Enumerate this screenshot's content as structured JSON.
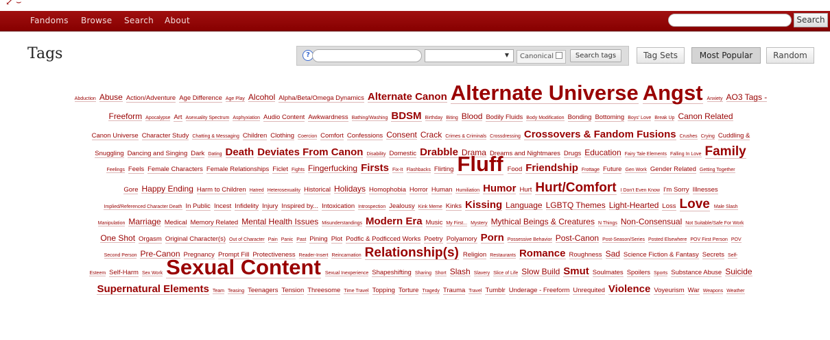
{
  "nav": {
    "items": [
      "Fandoms",
      "Browse",
      "Search",
      "About"
    ],
    "search_button": "Search",
    "search_placeholder": ""
  },
  "page": {
    "title": "Tags"
  },
  "tag_search": {
    "help_label": "?",
    "canonical_label": "Canonical",
    "search_button": "Search tags"
  },
  "buttons": {
    "tag_sets": "Tag Sets",
    "most_popular": "Most Popular",
    "random": "Random"
  },
  "colors": {
    "navbar": "#990000",
    "tag": "#990000"
  },
  "cloud": [
    [
      [
        "Abduction",
        1
      ],
      [
        "Abuse",
        3
      ],
      [
        "Action/Adventure",
        2
      ],
      [
        "Age Difference",
        2
      ],
      [
        "Age Play",
        1
      ],
      [
        "Alcohol",
        3
      ],
      [
        "Alpha/Beta/Omega Dynamics",
        2
      ],
      [
        "Alternate Canon",
        4
      ],
      [
        "Alternate Universe",
        6
      ],
      [
        "Angst",
        6
      ],
      [
        "Anxiety",
        1
      ],
      [
        "AO3 Tags -",
        3
      ]
    ],
    [
      [
        "Freeform",
        3
      ],
      [
        "Apocalypse",
        1
      ],
      [
        "Art",
        2
      ],
      [
        "Asexuality Spectrum",
        1
      ],
      [
        "Asphyxiation",
        1
      ],
      [
        "Audio Content",
        2
      ],
      [
        "Awkwardness",
        2
      ],
      [
        "Bathing/Washing",
        1
      ],
      [
        "BDSM",
        4
      ],
      [
        "Birthday",
        1
      ],
      [
        "Biting",
        1
      ],
      [
        "Blood",
        3
      ],
      [
        "Bodily Fluids",
        2
      ],
      [
        "Body Modification",
        1
      ],
      [
        "Bonding",
        2
      ],
      [
        "Bottoming",
        2
      ],
      [
        "Boys' Love",
        1
      ],
      [
        "Break Up",
        1
      ],
      [
        "Canon Related",
        3
      ]
    ],
    [
      [
        "Canon Universe",
        2
      ],
      [
        "Character Study",
        2
      ],
      [
        "Chatting & Messaging",
        1
      ],
      [
        "Children",
        2
      ],
      [
        "Clothing",
        2
      ],
      [
        "Coercion",
        1
      ],
      [
        "Comfort",
        2
      ],
      [
        "Confessions",
        2
      ],
      [
        "Consent",
        3
      ],
      [
        "Crack",
        3
      ],
      [
        "Crimes & Criminals",
        1
      ],
      [
        "Crossdressing",
        1
      ],
      [
        "Crossovers & Fandom Fusions",
        4
      ],
      [
        "Crushes",
        1
      ],
      [
        "Crying",
        1
      ],
      [
        "Cuddling &",
        2
      ]
    ],
    [
      [
        "Snuggling",
        2
      ],
      [
        "Dancing and Singing",
        2
      ],
      [
        "Dark",
        2
      ],
      [
        "Dating",
        1
      ],
      [
        "Death",
        4
      ],
      [
        "Deviates From Canon",
        4
      ],
      [
        "Disability",
        1
      ],
      [
        "Domestic",
        2
      ],
      [
        "Drabble",
        4
      ],
      [
        "Drama",
        3
      ],
      [
        "Dreams and Nightmares",
        2
      ],
      [
        "Drugs",
        2
      ],
      [
        "Education",
        3
      ],
      [
        "Fairy Tale Elements",
        1
      ],
      [
        "Falling In Love",
        1
      ],
      [
        "Family",
        5
      ]
    ],
    [
      [
        "Feelings",
        1
      ],
      [
        "Feels",
        2
      ],
      [
        "Female Characters",
        2
      ],
      [
        "Female Relationships",
        2
      ],
      [
        "Ficlet",
        2
      ],
      [
        "Fights",
        1
      ],
      [
        "Fingerfucking",
        3
      ],
      [
        "Firsts",
        4
      ],
      [
        "Fix-It",
        1
      ],
      [
        "Flashbacks",
        1
      ],
      [
        "Flirting",
        2
      ],
      [
        "Fluff",
        6
      ],
      [
        "Food",
        2
      ],
      [
        "Friendship",
        4
      ],
      [
        "Frottage",
        1
      ],
      [
        "Future",
        2
      ],
      [
        "Gen Work",
        1
      ],
      [
        "Gender Related",
        2
      ],
      [
        "Getting Together",
        1
      ]
    ],
    [
      [
        "Gore",
        2
      ],
      [
        "Happy Ending",
        3
      ],
      [
        "Harm to Children",
        2
      ],
      [
        "Hatred",
        1
      ],
      [
        "Heterosexuality",
        1
      ],
      [
        "Historical",
        2
      ],
      [
        "Holidays",
        3
      ],
      [
        "Homophobia",
        2
      ],
      [
        "Horror",
        2
      ],
      [
        "Human",
        2
      ],
      [
        "Humiliation",
        1
      ],
      [
        "Humor",
        4
      ],
      [
        "Hurt",
        2
      ],
      [
        "Hurt/Comfort",
        5
      ],
      [
        "I Don't Even Know",
        1
      ],
      [
        "I'm Sorry",
        2
      ],
      [
        "Illnesses",
        2
      ]
    ],
    [
      [
        "Implied/Referenced Character Death",
        1
      ],
      [
        "In Public",
        2
      ],
      [
        "Incest",
        2
      ],
      [
        "Infidelity",
        2
      ],
      [
        "Injury",
        2
      ],
      [
        "Inspired by...",
        2
      ],
      [
        "Intoxication",
        2
      ],
      [
        "Introspection",
        1
      ],
      [
        "Jealousy",
        2
      ],
      [
        "Kink Meme",
        1
      ],
      [
        "Kinks",
        2
      ],
      [
        "Kissing",
        4
      ],
      [
        "Language",
        3
      ],
      [
        "LGBTQ Themes",
        3
      ],
      [
        "Light-Hearted",
        3
      ],
      [
        "Loss",
        2
      ],
      [
        "Love",
        5
      ],
      [
        "Male Slash",
        1
      ]
    ],
    [
      [
        "Manipulation",
        1
      ],
      [
        "Marriage",
        3
      ],
      [
        "Medical",
        2
      ],
      [
        "Memory Related",
        2
      ],
      [
        "Mental Health Issues",
        3
      ],
      [
        "Misunderstandings",
        1
      ],
      [
        "Modern Era",
        4
      ],
      [
        "Music",
        2
      ],
      [
        "My First...",
        1
      ],
      [
        "Mystery",
        1
      ],
      [
        "Mythical Beings & Creatures",
        3
      ],
      [
        "N Things",
        1
      ],
      [
        "Non-Consensual",
        3
      ],
      [
        "Not Suitable/Safe For Work",
        1
      ]
    ],
    [
      [
        "One Shot",
        3
      ],
      [
        "Orgasm",
        2
      ],
      [
        "Original Character(s)",
        2
      ],
      [
        "Out of Character",
        1
      ],
      [
        "Pain",
        1
      ],
      [
        "Panic",
        1
      ],
      [
        "Past",
        1
      ],
      [
        "Pining",
        2
      ],
      [
        "Plot",
        2
      ],
      [
        "Podfic & Podficced Works",
        2
      ],
      [
        "Poetry",
        2
      ],
      [
        "Polyamory",
        2
      ],
      [
        "Porn",
        4
      ],
      [
        "Possessive Behavior",
        1
      ],
      [
        "Post-Canon",
        3
      ],
      [
        "Post-Season/Series",
        1
      ],
      [
        "Posted Elsewhere",
        1
      ],
      [
        "POV First Person",
        1
      ],
      [
        "POV",
        1
      ]
    ],
    [
      [
        "Second Person",
        1
      ],
      [
        "Pre-Canon",
        3
      ],
      [
        "Pregnancy",
        2
      ],
      [
        "Prompt Fill",
        2
      ],
      [
        "Protectiveness",
        2
      ],
      [
        "Reader-Insert",
        1
      ],
      [
        "Reincarnation",
        1
      ],
      [
        "Relationship(s)",
        5
      ],
      [
        "Religion",
        2
      ],
      [
        "Restaurants",
        1
      ],
      [
        "Romance",
        4
      ],
      [
        "Roughness",
        2
      ],
      [
        "Sad",
        3
      ],
      [
        "Science Fiction & Fantasy",
        2
      ],
      [
        "Secrets",
        2
      ],
      [
        "Self-",
        1
      ]
    ],
    [
      [
        "Esteem",
        1
      ],
      [
        "Self-Harm",
        2
      ],
      [
        "Sex Work",
        1
      ],
      [
        "Sexual Content",
        6
      ],
      [
        "Sexual Inexperience",
        1
      ],
      [
        "Shapeshifting",
        2
      ],
      [
        "Sharing",
        1
      ],
      [
        "Short",
        1
      ],
      [
        "Slash",
        3
      ],
      [
        "Slavery",
        1
      ],
      [
        "Slice of Life",
        1
      ],
      [
        "Slow Build",
        3
      ],
      [
        "Smut",
        4
      ],
      [
        "Soulmates",
        2
      ],
      [
        "Spoilers",
        2
      ],
      [
        "Sports",
        1
      ],
      [
        "Substance Abuse",
        2
      ],
      [
        "Suicide",
        3
      ]
    ],
    [
      [
        "Supernatural Elements",
        4
      ],
      [
        "Team",
        1
      ],
      [
        "Teasing",
        1
      ],
      [
        "Teenagers",
        2
      ],
      [
        "Tension",
        2
      ],
      [
        "Threesome",
        2
      ],
      [
        "Time Travel",
        1
      ],
      [
        "Topping",
        2
      ],
      [
        "Torture",
        2
      ],
      [
        "Tragedy",
        1
      ],
      [
        "Trauma",
        2
      ],
      [
        "Travel",
        1
      ],
      [
        "Tumblr",
        2
      ],
      [
        "Underage - Freeform",
        2
      ],
      [
        "Unrequited",
        2
      ],
      [
        "Violence",
        4
      ],
      [
        "Voyeurism",
        2
      ],
      [
        "War",
        2
      ],
      [
        "Weapons",
        1
      ],
      [
        "Weather",
        1
      ]
    ]
  ]
}
